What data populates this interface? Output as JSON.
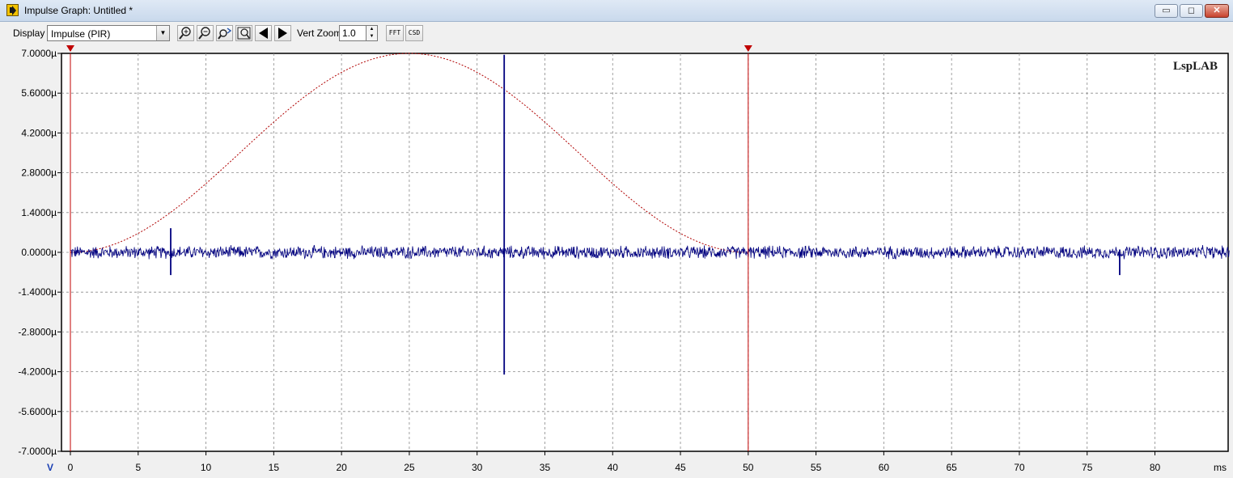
{
  "window": {
    "title": "Impulse Graph: Untitled *",
    "buttons": {
      "minimize": "▭",
      "maximize": "◻",
      "close": "✕"
    }
  },
  "toolbar": {
    "display_label": "Display",
    "display_value": "Impulse (PIR)",
    "tool_icons": [
      "zoom-in-icon",
      "zoom-out-icon",
      "zoom-reset-icon",
      "zoom-fit-icon",
      "scroll-left-icon",
      "scroll-right-icon"
    ],
    "vert_zoom_label": "Vert Zoom",
    "vert_zoom_value": "1.0",
    "fft_label": "FFT",
    "csd_label": "CSD"
  },
  "graph": {
    "brand": "LspLAB",
    "y_unit": "V",
    "x_unit": "ms",
    "colors": {
      "trace": "#00007f",
      "window": "#b00000",
      "markers": "#c00000",
      "grid": "#8a8a8a"
    }
  },
  "chart_data": {
    "type": "line",
    "title": "",
    "xlabel": "ms",
    "ylabel": "V",
    "xlim": [
      0,
      85.5
    ],
    "ylim": [
      -7.0,
      7.0
    ],
    "y_unit_suffix": "µ",
    "y_ticks": [
      "7.0000µ",
      "5.6000µ",
      "4.2000µ",
      "2.8000µ",
      "1.4000µ",
      "0.0000µ",
      "-1.4000µ",
      "-2.8000µ",
      "-4.2000µ",
      "-5.6000µ",
      "-7.0000µ"
    ],
    "x_ticks": [
      "0",
      "5",
      "10",
      "15",
      "20",
      "25",
      "30",
      "35",
      "40",
      "45",
      "50",
      "55",
      "60",
      "65",
      "70",
      "75",
      "80"
    ],
    "grid": true,
    "markers_ms": [
      0,
      50
    ],
    "series": [
      {
        "kind": "noise-impulse",
        "noise_amplitude": 0.22,
        "spikes": [
          {
            "x": 7.4,
            "peak": 0.85,
            "trough": -0.8
          },
          {
            "x": 32.0,
            "peak": 6.95,
            "trough": -4.3
          },
          {
            "x": 77.4,
            "peak": 0.1,
            "trough": -0.8
          }
        ]
      },
      {
        "kind": "window",
        "shape": "raised-cosine",
        "x_start": 0,
        "x_peak": 25,
        "x_end": 50,
        "peak": 7.0
      }
    ]
  }
}
